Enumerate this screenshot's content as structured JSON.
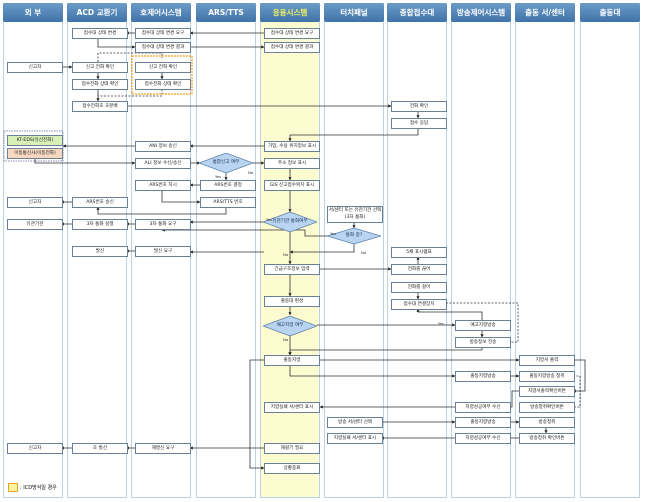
{
  "lanes": [
    "외 부",
    "ACD 교환기",
    "호제어시스템",
    "ARS/TTS",
    "응용시스템",
    "터치패널",
    "종합접수대",
    "방송제어시스템",
    "출동 서/센터",
    "출동대"
  ],
  "boxes": {
    "acd_status_change": "접수대 상태 변경",
    "ctrl_status_req": "접수대 상태 변경 요구",
    "app_status_req": "접수대 상태 변경 요구",
    "ctrl_status_result": "접수대 상태 변경 결과",
    "app_status_result": "접수대 상태 변경 결과",
    "ext_caller1": "신고자",
    "acd_call_check": "신고 전화 확인",
    "ctrl_call_check": "신고 전화 확인",
    "acd_line_check": "접수전화 상태 확인",
    "ctrl_line_check": "접수전화 상태 확인",
    "acd_distribute": "접수전화호 호분배",
    "desk_call_check": "전화 확인",
    "desk_answer": "접수 응답",
    "ext_kt": "KT-EDS(유선전화)",
    "ext_mobile": "이동통신사(이동전화)",
    "ctrl_ani": "ANI 정보 송신",
    "app_location": "가입, 수용 위치정보 표시",
    "ctrl_ali": "ALI 정보 수신/송신",
    "app_address": "주소 정보 표시",
    "ctrl_ars_cmd": "ARS번호 지시",
    "ars_decide": "ARS번호 결정",
    "app_gis": "GIS 신고접수위치 표시",
    "ext_caller2": "신고자",
    "acd_ars_send": "ARS번호 송신",
    "ars_tts": "ARS/TTS 번호",
    "ext_agency": "유관기관",
    "acd_3way": "3자 통화 실행",
    "ctrl_3way": "3자 통화 요구",
    "touch_select": "서/센터 또는 유관기관 선택 (3자 통화)",
    "acd_dial": "발신",
    "ctrl_dial": "발신 요구",
    "desk_lamp": "5채 표시램프",
    "app_rescue_input": "긴급구조정보 입력",
    "desk_hangup": "전화를 끊어",
    "app_unit_form": "출동대 편성",
    "desk_call": "전화를 걸어",
    "desk_connect": "접수대 연결장치",
    "bc_pre": "예고지령방송",
    "bc_info": "방송정보 전송",
    "app_dispatch": "출동지령",
    "st_print": "지령서 출력",
    "bc_dispatch1": "출동지령방송",
    "st_listen1": "출동지령방송 청취",
    "st_print_confirm": "지령서출력확인버튼",
    "app_fail": "지령실패 서/센터 표시",
    "bc_result1": "지령성공여부 수신",
    "st_listen_confirm1": "방송청취확인버튼",
    "touch_bc_select": "방송 서/센터 선택",
    "bc_dispatch2": "출동지령방송",
    "st_listen2": "방송청취",
    "touch_fail": "지령실패 서/센터 표시",
    "bc_result2": "지령성공여부 수신",
    "st_listen_confirm2": "방송청취 확인버튼",
    "ext_caller3": "신고자",
    "acd_call_out": "호 발신",
    "ctrl_redial": "재발신 요구",
    "app_redial": "재걸기 필요",
    "app_end": "상황종료"
  },
  "decisions": {
    "integrated": "통합신고 여부",
    "agency": "유관기관 통화여부",
    "busy": "통화 중?",
    "pre_order": "예고지령 여부"
  },
  "yes": "Yes",
  "no": "No",
  "legend": ": ICD방식일 경우",
  "colors": {
    "header": "#4f82b5",
    "highlight_lane": "#fdfbd0",
    "icd_box": "#f0a020",
    "kt": "#d6f0b8",
    "mobile": "#f8d8c0"
  }
}
